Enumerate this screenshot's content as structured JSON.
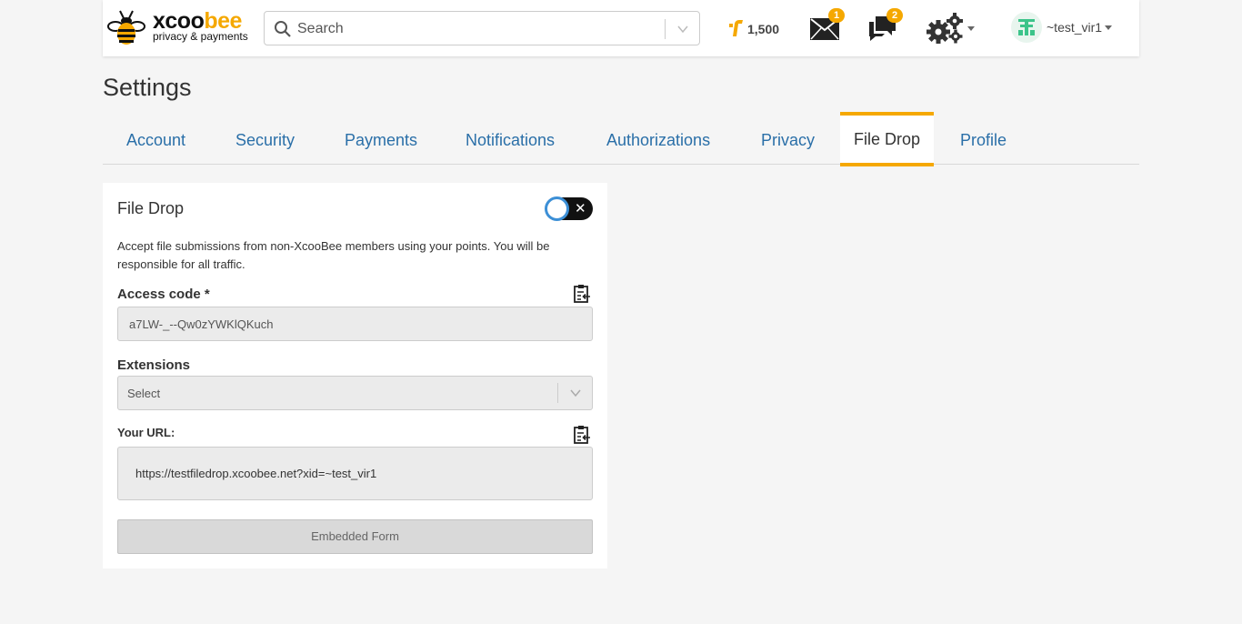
{
  "header": {
    "logo": {
      "word_dark": "xcoo",
      "word_accent": "bee",
      "tagline": "privacy & payments"
    },
    "search": {
      "placeholder": "Search"
    },
    "points": {
      "value": "1,500",
      "icon": "points-icon"
    },
    "messages": {
      "icon": "envelope-icon",
      "badge": "1"
    },
    "chats": {
      "icon": "chat-icon",
      "badge": "2"
    },
    "settings": {
      "icon": "gears-icon"
    },
    "user": {
      "name": "~test_vir1",
      "avatar_icon": "avatar-icon"
    }
  },
  "page": {
    "title": "Settings"
  },
  "tabs": [
    {
      "label": "Account"
    },
    {
      "label": "Security"
    },
    {
      "label": "Payments"
    },
    {
      "label": "Notifications"
    },
    {
      "label": "Authorizations"
    },
    {
      "label": "Privacy"
    },
    {
      "label": "File Drop",
      "active": true
    },
    {
      "label": "Profile"
    }
  ],
  "file_drop": {
    "title": "File Drop",
    "toggle": {
      "state": "off",
      "icon": "close-icon"
    },
    "description": "Accept file submissions from non-XcooBee members using your points. You will be responsible for all traffic.",
    "access_code": {
      "label": "Access code *",
      "value": "a7LW-_--Qw0zYWKlQKuch"
    },
    "extensions": {
      "label": "Extensions",
      "placeholder": "Select"
    },
    "your_url": {
      "label": "Your URL:",
      "value": "https://testfiledrop.xcoobee.net?xid=~test_vir1"
    },
    "embedded_form_button": "Embedded Form"
  },
  "colors": {
    "accent": "#f5a800",
    "link": "#2a6fa8",
    "background": "#f5f5f5"
  }
}
